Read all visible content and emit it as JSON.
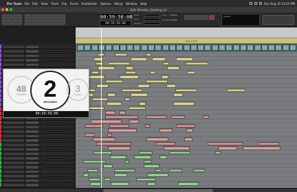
{
  "menubar": {
    "apple_glyph": "",
    "app_name": "Pro Tools",
    "items": [
      "File",
      "Edit",
      "View",
      "Track",
      "Clip",
      "Event",
      "AudioSuite",
      "Options",
      "Setup",
      "Window",
      "Help"
    ],
    "clock": "Sun Aug 10 12:15 PM"
  },
  "window": {
    "title": "Edit: Dresden_Spotting_v3"
  },
  "toolbar": {
    "main_counter": "00:59:58:00",
    "sub_counter": "00:59:58:00",
    "start_label": "Start",
    "end_label": "End",
    "length_label": "Length",
    "grid_label": "Grid",
    "nudge_label": "Nudge",
    "cursor_label": "Cursor",
    "grid_value": "1 frame",
    "nudge_value": "1 frame"
  },
  "countdown": {
    "left_number": "48",
    "left_label": "FRAMES",
    "center_number": "2",
    "center_label": "SECONDS",
    "right_number": "3",
    "right_label": "FRAMES",
    "timecode": "00:59:58:00"
  },
  "marker": {
    "text": "Reel 1 start"
  },
  "colors": {
    "clip_yellow": "#d7d39b",
    "clip_red": "#d2a2a3",
    "clip_green": "#9bcd9a",
    "track_purple": "#8a5bd6",
    "track_red": "#d23a3a",
    "track_green": "#3cb34a",
    "counter_text": "#f2f2f2"
  }
}
